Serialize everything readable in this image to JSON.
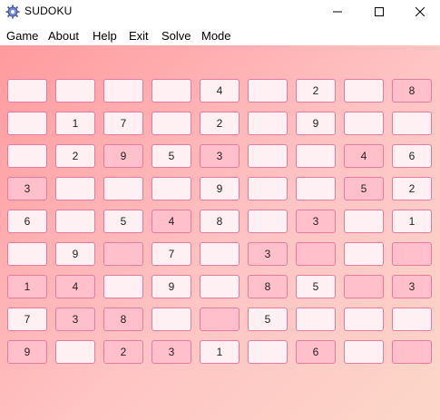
{
  "window": {
    "title": "SUDOKU",
    "icon": "app-gear-icon"
  },
  "menu": [
    "Game",
    "About",
    "Help",
    "Exit",
    "Solve",
    "Mode"
  ],
  "colors": {
    "cell_light": "#fff0f3",
    "cell_dark": "#ffbfcb",
    "cell_border": "#e57ba0",
    "background_start": "#ff9a9e",
    "background_end": "#fcd6c8"
  },
  "board": {
    "rows": [
      [
        "",
        "",
        "",
        "",
        "4",
        "",
        "2",
        "",
        "8"
      ],
      [
        "",
        "1",
        "7",
        "",
        "2",
        "",
        "9",
        "",
        ""
      ],
      [
        "",
        "2",
        "9",
        "5",
        "3",
        "",
        "",
        "4",
        "6"
      ],
      [
        "3",
        "",
        "",
        "",
        "9",
        "",
        "",
        "5",
        "2"
      ],
      [
        "6",
        "",
        "5",
        "4",
        "8",
        "",
        "3",
        "",
        "1"
      ],
      [
        "",
        "9",
        "",
        "7",
        "",
        "3",
        "",
        "",
        ""
      ],
      [
        "1",
        "4",
        "",
        "9",
        "",
        "8",
        "5",
        "",
        "3"
      ],
      [
        "7",
        "3",
        "8",
        "",
        "",
        "5",
        "",
        "",
        ""
      ],
      [
        "9",
        "",
        "2",
        "3",
        "1",
        "",
        "6",
        "",
        ""
      ]
    ],
    "shade": [
      [
        "l",
        "l",
        "l",
        "l",
        "l",
        "l",
        "l",
        "l",
        "d"
      ],
      [
        "l",
        "l",
        "l",
        "l",
        "l",
        "l",
        "l",
        "l",
        "l"
      ],
      [
        "l",
        "l",
        "d",
        "l",
        "d",
        "l",
        "l",
        "d",
        "l"
      ],
      [
        "d",
        "l",
        "l",
        "l",
        "l",
        "l",
        "l",
        "d",
        "l"
      ],
      [
        "l",
        "l",
        "l",
        "d",
        "l",
        "l",
        "d",
        "l",
        "l"
      ],
      [
        "l",
        "l",
        "d",
        "l",
        "l",
        "d",
        "d",
        "l",
        "d"
      ],
      [
        "d",
        "d",
        "l",
        "l",
        "l",
        "d",
        "l",
        "d",
        "d"
      ],
      [
        "l",
        "d",
        "d",
        "l",
        "d",
        "l",
        "l",
        "l",
        "l"
      ],
      [
        "d",
        "l",
        "d",
        "d",
        "l",
        "l",
        "d",
        "l",
        "d"
      ]
    ]
  }
}
